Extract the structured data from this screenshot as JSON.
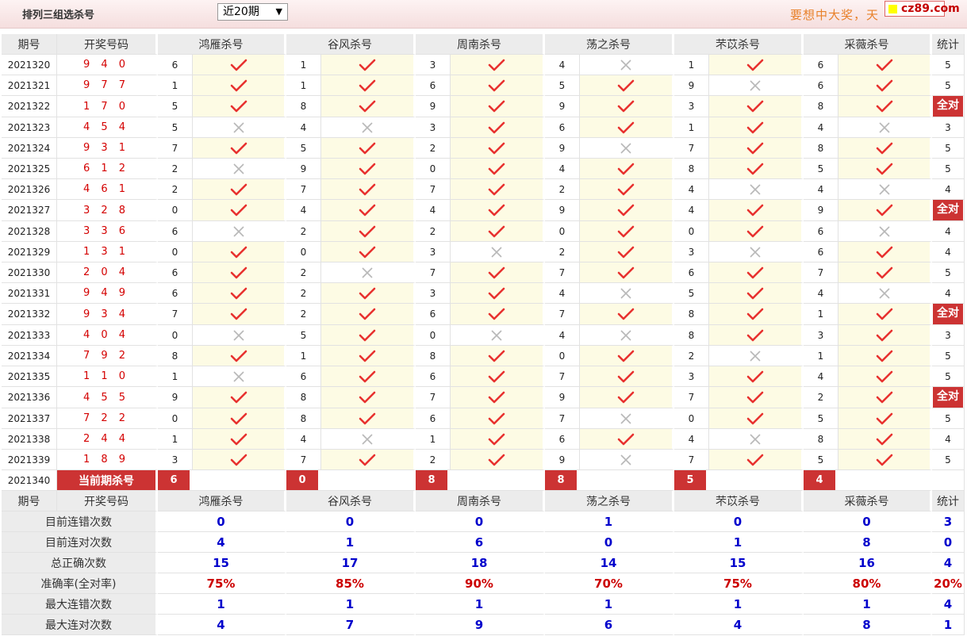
{
  "header": {
    "title": "排列三组选杀号",
    "period_select": "近20期",
    "slogan": "要想中大奖，天",
    "logo": "cz89.com"
  },
  "columns": {
    "issue": "期号",
    "draw": "开奖号码",
    "experts": [
      "鸿雁杀号",
      "谷风杀号",
      "周南杀号",
      "荡之杀号",
      "芣苡杀号",
      "采薇杀号"
    ],
    "stat": "统计"
  },
  "rows": [
    {
      "issue": "2021320",
      "draw": "9 4 0",
      "kills": [
        [
          6,
          1
        ],
        [
          1,
          1
        ],
        [
          3,
          1
        ],
        [
          4,
          0
        ],
        [
          1,
          1
        ],
        [
          6,
          1
        ]
      ],
      "stat": "5"
    },
    {
      "issue": "2021321",
      "draw": "9 7 7",
      "kills": [
        [
          1,
          1
        ],
        [
          1,
          1
        ],
        [
          6,
          1
        ],
        [
          5,
          1
        ],
        [
          9,
          0
        ],
        [
          6,
          1
        ]
      ],
      "stat": "5"
    },
    {
      "issue": "2021322",
      "draw": "1 7 0",
      "kills": [
        [
          5,
          1
        ],
        [
          8,
          1
        ],
        [
          9,
          1
        ],
        [
          9,
          1
        ],
        [
          3,
          1
        ],
        [
          8,
          1
        ]
      ],
      "stat": "全对"
    },
    {
      "issue": "2021323",
      "draw": "4 5 4",
      "kills": [
        [
          5,
          0
        ],
        [
          4,
          0
        ],
        [
          3,
          1
        ],
        [
          6,
          1
        ],
        [
          1,
          1
        ],
        [
          4,
          0
        ]
      ],
      "stat": "3"
    },
    {
      "issue": "2021324",
      "draw": "9 3 1",
      "kills": [
        [
          7,
          1
        ],
        [
          5,
          1
        ],
        [
          2,
          1
        ],
        [
          9,
          0
        ],
        [
          7,
          1
        ],
        [
          8,
          1
        ]
      ],
      "stat": "5"
    },
    {
      "issue": "2021325",
      "draw": "6 1 2",
      "kills": [
        [
          2,
          0
        ],
        [
          9,
          1
        ],
        [
          0,
          1
        ],
        [
          4,
          1
        ],
        [
          8,
          1
        ],
        [
          5,
          1
        ]
      ],
      "stat": "5"
    },
    {
      "issue": "2021326",
      "draw": "4 6 1",
      "kills": [
        [
          2,
          1
        ],
        [
          7,
          1
        ],
        [
          7,
          1
        ],
        [
          2,
          1
        ],
        [
          4,
          0
        ],
        [
          4,
          0
        ]
      ],
      "stat": "4"
    },
    {
      "issue": "2021327",
      "draw": "3 2 8",
      "kills": [
        [
          0,
          1
        ],
        [
          4,
          1
        ],
        [
          4,
          1
        ],
        [
          9,
          1
        ],
        [
          4,
          1
        ],
        [
          9,
          1
        ]
      ],
      "stat": "全对"
    },
    {
      "issue": "2021328",
      "draw": "3 3 6",
      "kills": [
        [
          6,
          0
        ],
        [
          2,
          1
        ],
        [
          2,
          1
        ],
        [
          0,
          1
        ],
        [
          0,
          1
        ],
        [
          6,
          0
        ]
      ],
      "stat": "4"
    },
    {
      "issue": "2021329",
      "draw": "1 3 1",
      "kills": [
        [
          0,
          1
        ],
        [
          0,
          1
        ],
        [
          3,
          0
        ],
        [
          2,
          1
        ],
        [
          3,
          0
        ],
        [
          6,
          1
        ]
      ],
      "stat": "4"
    },
    {
      "issue": "2021330",
      "draw": "2 0 4",
      "kills": [
        [
          6,
          1
        ],
        [
          2,
          0
        ],
        [
          7,
          1
        ],
        [
          7,
          1
        ],
        [
          6,
          1
        ],
        [
          7,
          1
        ]
      ],
      "stat": "5"
    },
    {
      "issue": "2021331",
      "draw": "9 4 9",
      "kills": [
        [
          6,
          1
        ],
        [
          2,
          1
        ],
        [
          3,
          1
        ],
        [
          4,
          0
        ],
        [
          5,
          1
        ],
        [
          4,
          0
        ]
      ],
      "stat": "4"
    },
    {
      "issue": "2021332",
      "draw": "9 3 4",
      "kills": [
        [
          7,
          1
        ],
        [
          2,
          1
        ],
        [
          6,
          1
        ],
        [
          7,
          1
        ],
        [
          8,
          1
        ],
        [
          1,
          1
        ]
      ],
      "stat": "全对"
    },
    {
      "issue": "2021333",
      "draw": "4 0 4",
      "kills": [
        [
          0,
          0
        ],
        [
          5,
          1
        ],
        [
          0,
          0
        ],
        [
          4,
          0
        ],
        [
          8,
          1
        ],
        [
          3,
          1
        ]
      ],
      "stat": "3"
    },
    {
      "issue": "2021334",
      "draw": "7 9 2",
      "kills": [
        [
          8,
          1
        ],
        [
          1,
          1
        ],
        [
          8,
          1
        ],
        [
          0,
          1
        ],
        [
          2,
          0
        ],
        [
          1,
          1
        ]
      ],
      "stat": "5"
    },
    {
      "issue": "2021335",
      "draw": "1 1 0",
      "kills": [
        [
          1,
          0
        ],
        [
          6,
          1
        ],
        [
          6,
          1
        ],
        [
          7,
          1
        ],
        [
          3,
          1
        ],
        [
          4,
          1
        ]
      ],
      "stat": "5"
    },
    {
      "issue": "2021336",
      "draw": "4 5 5",
      "kills": [
        [
          9,
          1
        ],
        [
          8,
          1
        ],
        [
          7,
          1
        ],
        [
          9,
          1
        ],
        [
          7,
          1
        ],
        [
          2,
          1
        ]
      ],
      "stat": "全对"
    },
    {
      "issue": "2021337",
      "draw": "7 2 2",
      "kills": [
        [
          0,
          1
        ],
        [
          8,
          1
        ],
        [
          6,
          1
        ],
        [
          7,
          0
        ],
        [
          0,
          1
        ],
        [
          5,
          1
        ]
      ],
      "stat": "5"
    },
    {
      "issue": "2021338",
      "draw": "2 4 4",
      "kills": [
        [
          1,
          1
        ],
        [
          4,
          0
        ],
        [
          1,
          1
        ],
        [
          6,
          1
        ],
        [
          4,
          0
        ],
        [
          8,
          1
        ]
      ],
      "stat": "4"
    },
    {
      "issue": "2021339",
      "draw": "1 8 9",
      "kills": [
        [
          3,
          1
        ],
        [
          7,
          1
        ],
        [
          2,
          1
        ],
        [
          9,
          0
        ],
        [
          7,
          1
        ],
        [
          5,
          1
        ]
      ],
      "stat": "5"
    }
  ],
  "current": {
    "issue": "2021340",
    "label": "当前期杀号",
    "kills": [
      "6",
      "0",
      "8",
      "8",
      "5",
      "4"
    ]
  },
  "summary": [
    {
      "label": "目前连错次数",
      "values": [
        "0",
        "0",
        "0",
        "1",
        "0",
        "0"
      ],
      "stat": "3",
      "red": false
    },
    {
      "label": "目前连对次数",
      "values": [
        "4",
        "1",
        "6",
        "0",
        "1",
        "8"
      ],
      "stat": "0",
      "red": false
    },
    {
      "label": "总正确次数",
      "values": [
        "15",
        "17",
        "18",
        "14",
        "15",
        "16"
      ],
      "stat": "4",
      "red": false
    },
    {
      "label": "准确率(全对率)",
      "values": [
        "75%",
        "85%",
        "90%",
        "70%",
        "75%",
        "80%"
      ],
      "stat": "20%",
      "red": true
    },
    {
      "label": "最大连错次数",
      "values": [
        "1",
        "1",
        "1",
        "1",
        "1",
        "1"
      ],
      "stat": "4",
      "red": false
    },
    {
      "label": "最大连对次数",
      "values": [
        "4",
        "7",
        "9",
        "6",
        "4",
        "8"
      ],
      "stat": "1",
      "red": false
    }
  ],
  "colors": {
    "accent": "#cc3333",
    "check": "#e8312f",
    "cross": "#b8b8b8",
    "highlight": "#fdfbe4",
    "header_bg": "#ececec"
  },
  "icons": {
    "correct": "check-icon",
    "wrong": "cross-icon"
  }
}
